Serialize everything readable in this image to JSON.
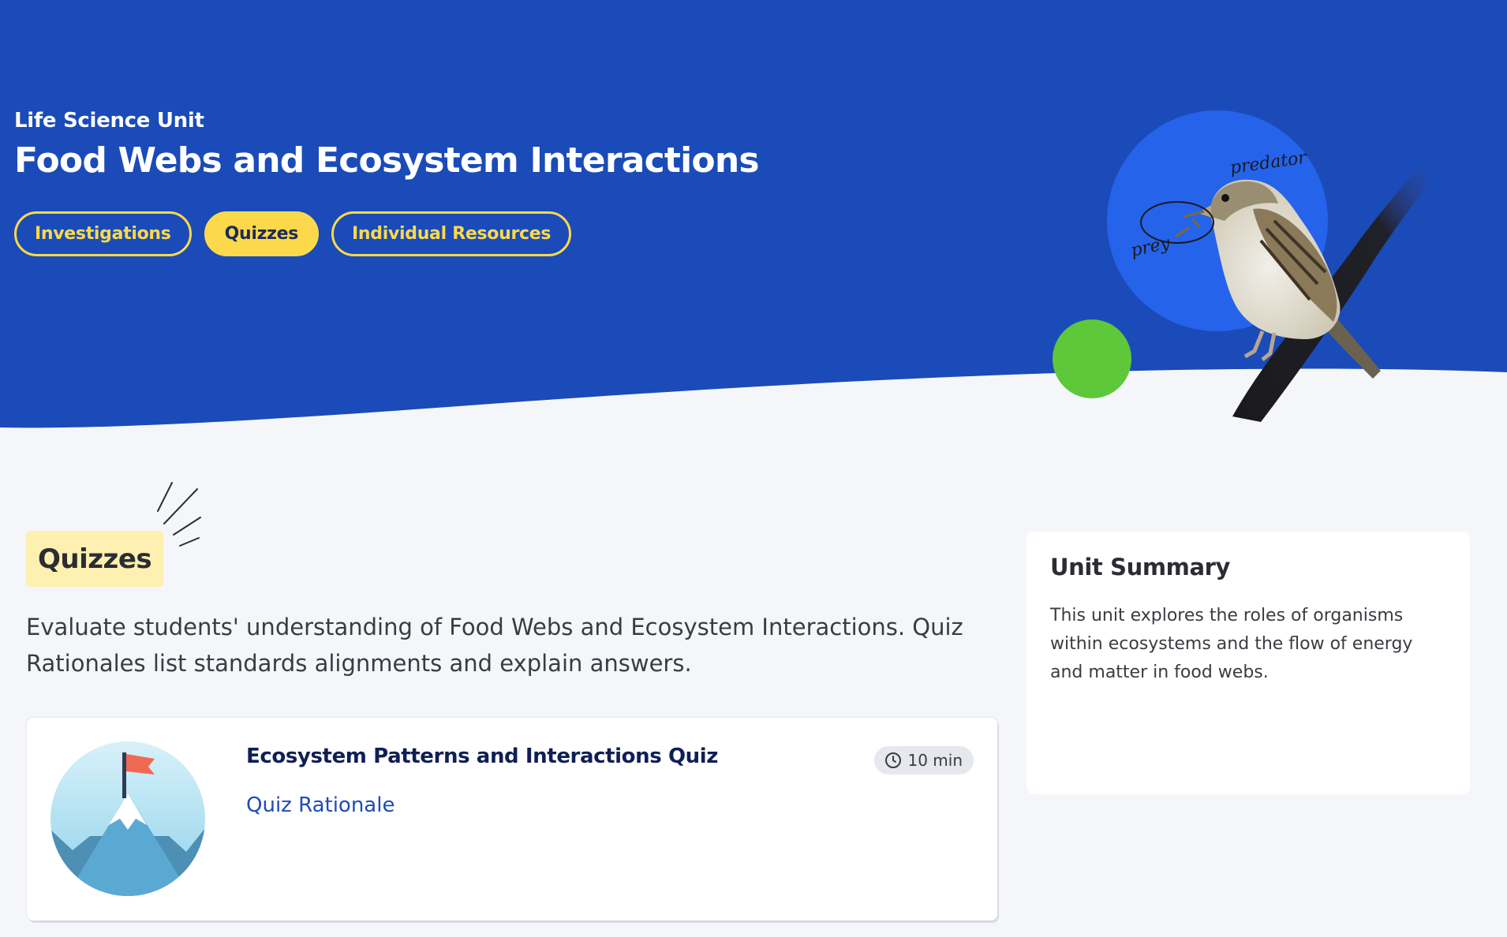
{
  "hero": {
    "eyebrow": "Life Science Unit",
    "title": "Food Webs and Ecosystem Interactions",
    "tabs": [
      {
        "label": "Investigations",
        "active": false
      },
      {
        "label": "Quizzes",
        "active": true
      },
      {
        "label": "Individual Resources",
        "active": false
      }
    ],
    "illustration": {
      "predator_label": "predator",
      "prey_label": "prey",
      "subject": "sparrow-with-insect"
    },
    "colors": {
      "banner": "#1a4bb8",
      "accent": "#fcd94a",
      "circle_blue": "#2563eb",
      "circle_green": "#5ec83a"
    }
  },
  "section": {
    "tag": "Quizzes",
    "description": "Evaluate students' understanding of Food Webs and Ecosystem Interactions. Quiz Rationales list standards alignments and explain answers."
  },
  "quizzes": [
    {
      "title": "Ecosystem Patterns and Interactions Quiz",
      "link": "Quiz Rationale",
      "duration": "10 min",
      "thumbnail_icon": "mountain-flag-icon"
    }
  ],
  "summary": {
    "title": "Unit Summary",
    "body": "This unit explores the roles of organisms within ecosystems and the flow of energy and matter in food webs."
  }
}
